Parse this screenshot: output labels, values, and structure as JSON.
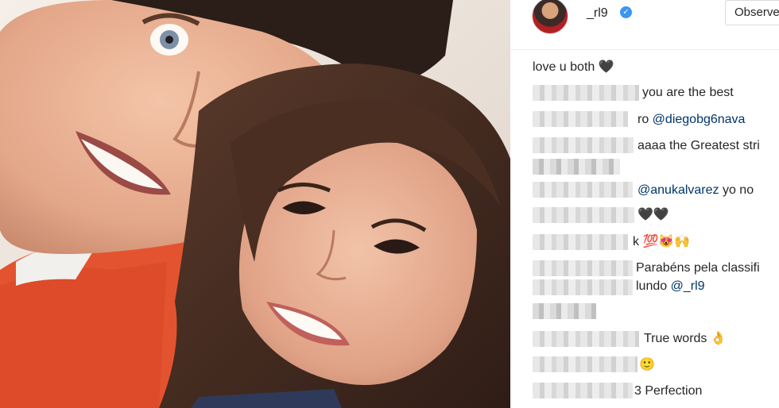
{
  "post": {
    "username": "_rl9",
    "follow_label": "Observe"
  },
  "icons": {
    "verified": "verified-badge-icon"
  },
  "comments": [
    {
      "text": "love u both 🖤"
    },
    {
      "text": "you are the best"
    },
    {
      "prefix": "ro ",
      "mention": "@diegobg6nava"
    },
    {
      "text": "aaaa the Greatest stri"
    },
    {
      "text": ""
    },
    {
      "mention": "@anukalvarez",
      "suffix": " yo no"
    },
    {
      "text": "🖤🖤"
    },
    {
      "text": "k 💯😻🙌"
    },
    {
      "text": "Parabéns pela classifi"
    },
    {
      "prefix": "lundo ",
      "mention": "@_rl9"
    },
    {
      "text": ""
    },
    {
      "text": "True words 👌"
    },
    {
      "text": "🙂"
    },
    {
      "text": "3 Perfection"
    }
  ]
}
